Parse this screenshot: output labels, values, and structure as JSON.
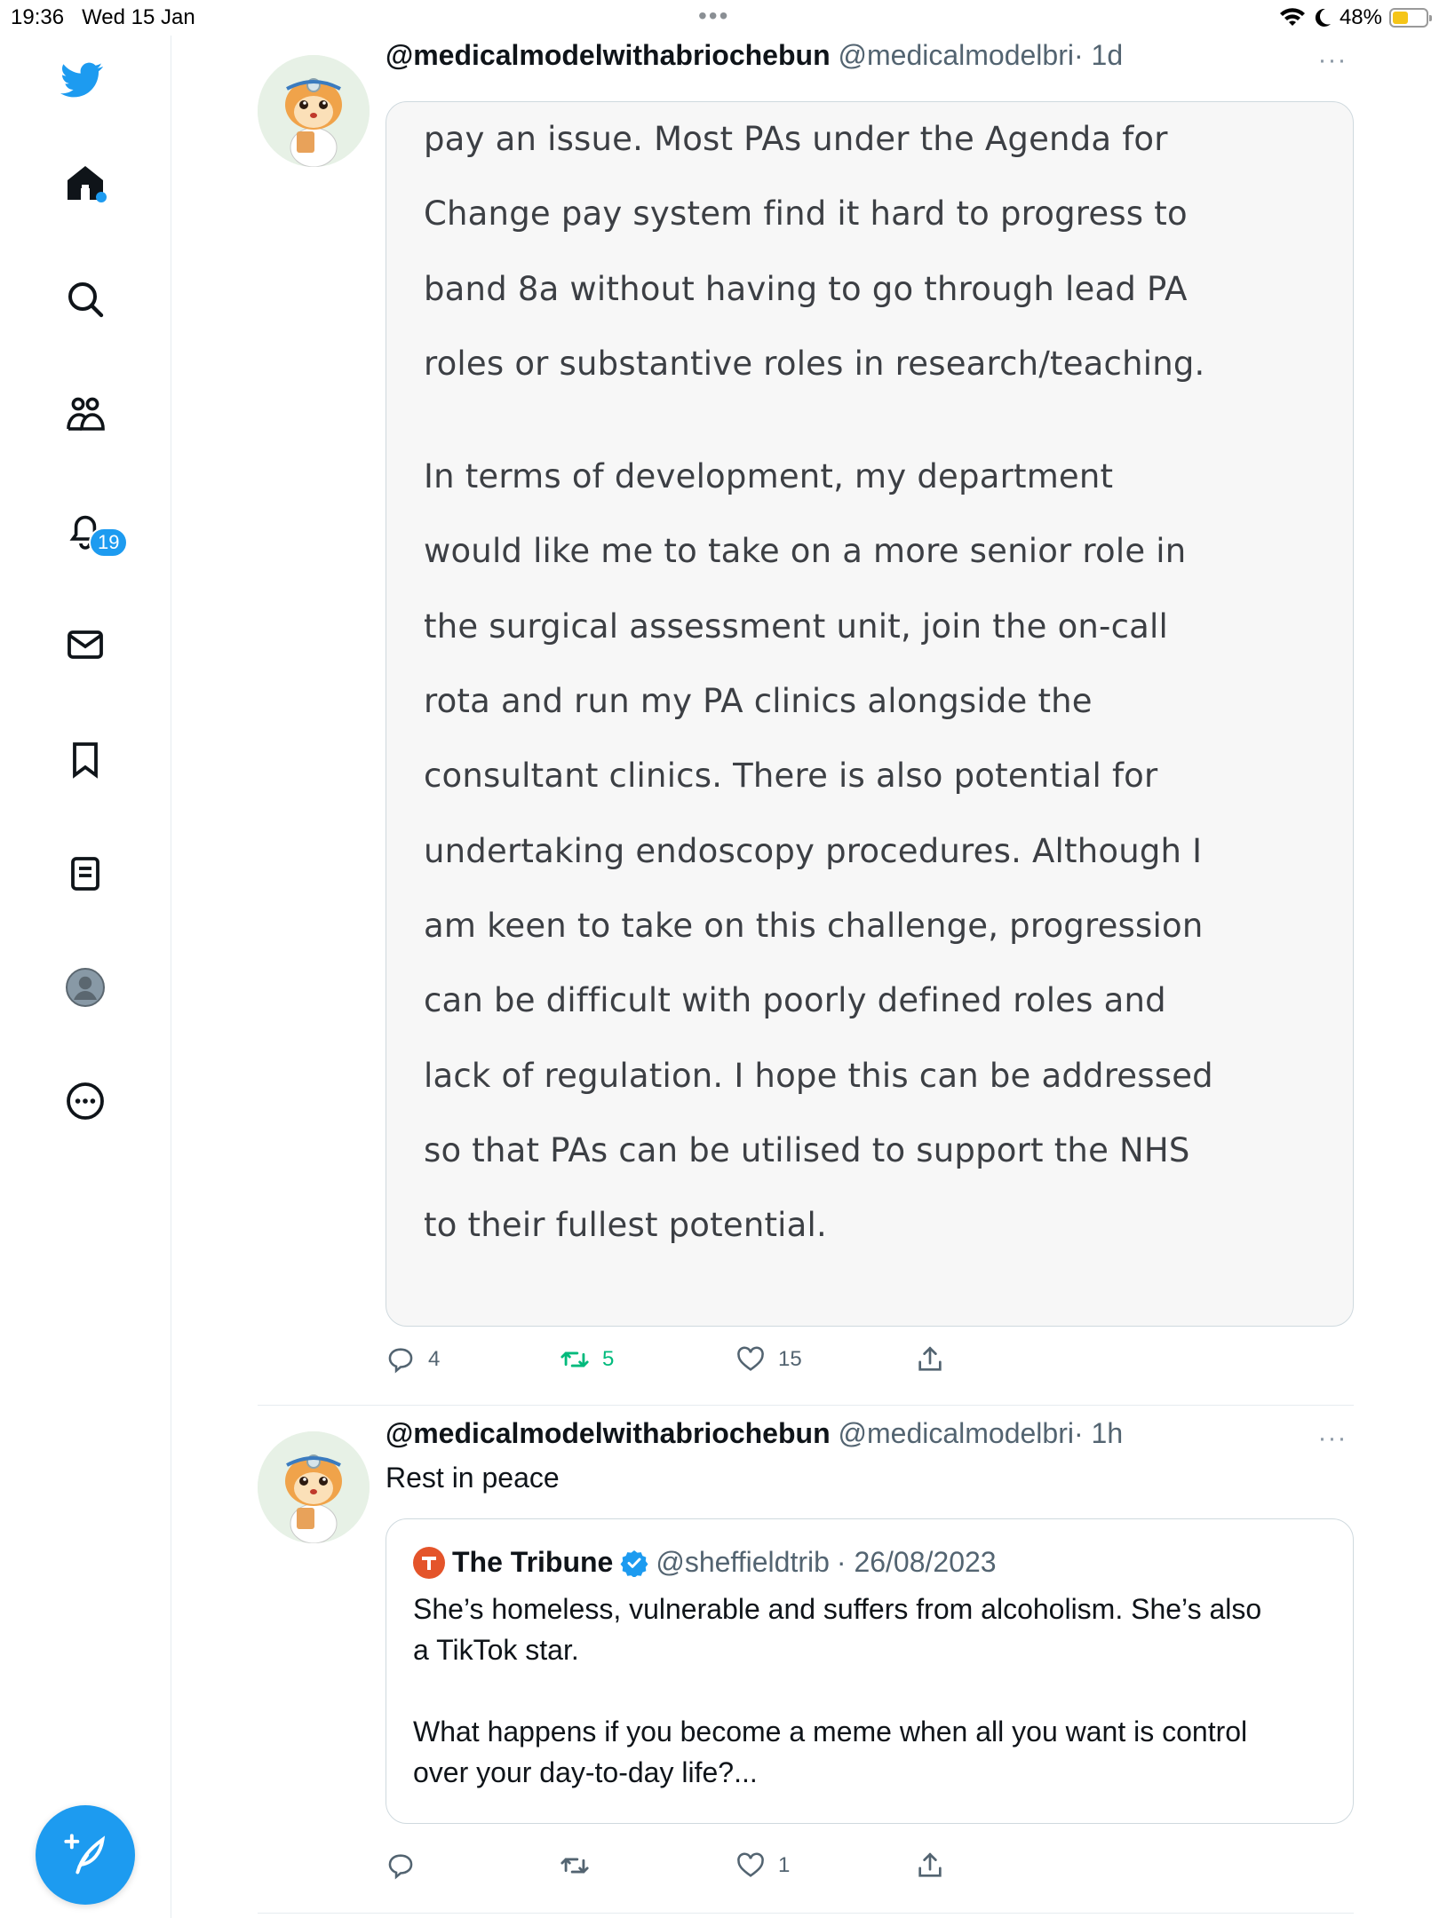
{
  "status_bar": {
    "time": "19:36",
    "date": "Wed 15 Jan",
    "battery": "48%",
    "battery_level": 0.48
  },
  "sidebar": {
    "notifications_badge": "19",
    "items": [
      "home-icon",
      "search-icon",
      "communities-icon",
      "notifications-icon",
      "messages-icon",
      "bookmarks-icon",
      "lists-icon",
      "profile-icon",
      "more-icon"
    ]
  },
  "tweets": [
    {
      "display_name": "@medicalmodelwithabriochebun",
      "handle": "@medicalmodelbri",
      "time": "· 1d",
      "image_text": {
        "para1": [
          "pay an issue. Most PAs under the Agenda for",
          "Change pay system find it hard to progress to",
          "band 8a without having to go through lead PA",
          "roles or substantive roles in research/teaching."
        ],
        "para2": [
          "In terms of development, my department",
          "would like me to take on a more senior role in",
          "the surgical assessment unit, join the on-call",
          "rota and run my PA clinics alongside the",
          "consultant clinics. There is also potential for",
          "undertaking endoscopy procedures. Although I",
          "am keen to take on this challenge, progression",
          "can be difficult with poorly defined roles and",
          "lack of regulation. I hope this can be addressed",
          "so that PAs can be utilised to support the NHS",
          "to their fullest potential."
        ]
      },
      "replies": "4",
      "retweets": "5",
      "likes": "15"
    },
    {
      "display_name": "@medicalmodelwithabriochebun",
      "handle": "@medicalmodelbri",
      "time": "· 1h",
      "text": "Rest in peace",
      "quote": {
        "name": "The Tribune",
        "handle": "@sheffieldtrib",
        "date": "· 26/08/2023",
        "line1": "She’s homeless, vulnerable and suffers from alcoholism. She’s also",
        "line2": "a TikTok star.",
        "line3": "What happens if you become a meme when all you want is control",
        "line4": "over your day-to-day life?..."
      },
      "replies": "",
      "retweets": "",
      "likes": "1"
    }
  ],
  "colors": {
    "accent": "#1d9bf0",
    "retweet_active": "#00ba7c",
    "secondary_text": "#536471",
    "border": "#cfd9de"
  }
}
